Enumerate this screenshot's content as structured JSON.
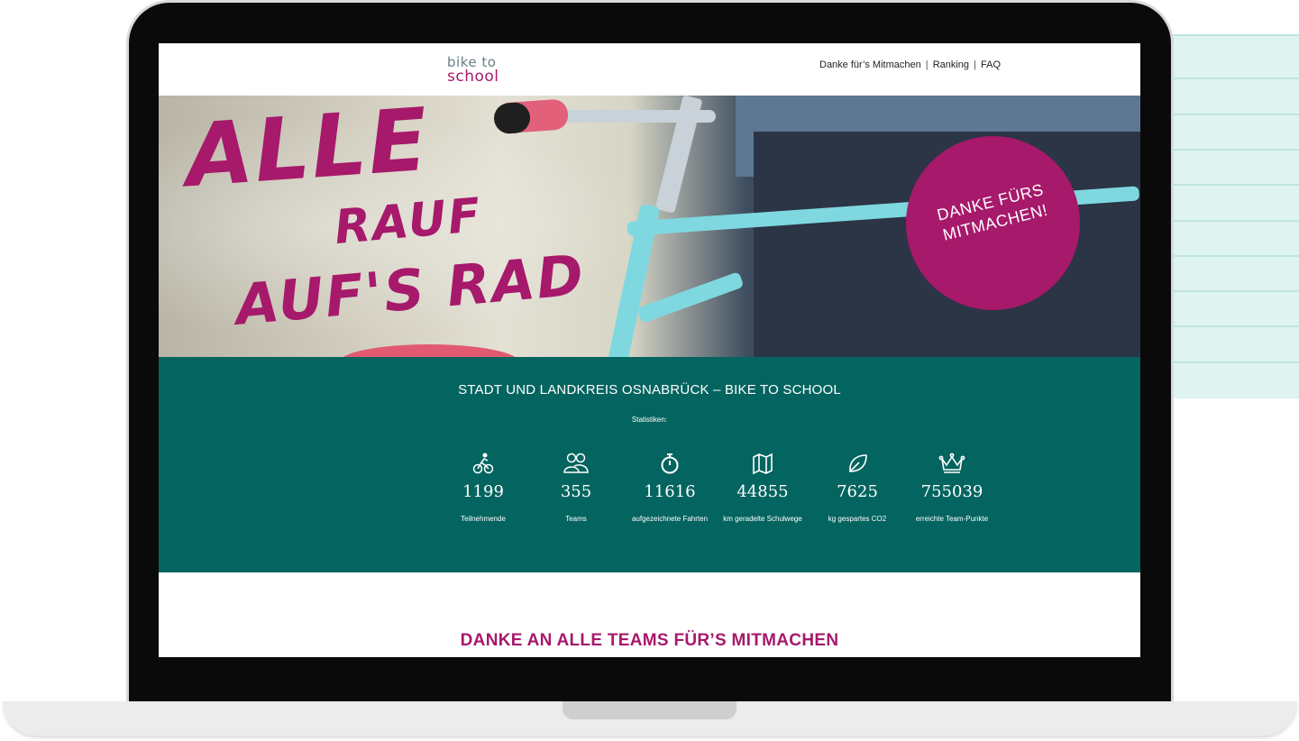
{
  "logo": {
    "line1": "bike to",
    "line2": "school"
  },
  "nav": {
    "items": [
      "Danke für’s Mitmachen",
      "Ranking",
      "FAQ"
    ],
    "separator": "|"
  },
  "hero": {
    "title_line1": "ALLE",
    "title_line2": "RAUF",
    "title_line3": "AUF'S RAD",
    "badge": "DANKE FÜRS MITMACHEN!"
  },
  "stats": {
    "title": "STADT UND LANDKREIS OSNABRÜCK – BIKE TO SCHOOL",
    "subtitle": "Statistiken:",
    "items": [
      {
        "icon": "cyclist-icon",
        "value": "1199",
        "label": "Teilnehmende"
      },
      {
        "icon": "team-icon",
        "value": "355",
        "label": "Teams"
      },
      {
        "icon": "stopwatch-icon",
        "value": "11616",
        "label": "aufgezeichnete Fahrten"
      },
      {
        "icon": "map-icon",
        "value": "44855",
        "label": "km geradelte Schulwege"
      },
      {
        "icon": "leaf-icon",
        "value": "7625",
        "label": "kg gespartes CO2"
      },
      {
        "icon": "crown-icon",
        "value": "755039",
        "label": "erreichte Team-Punkte"
      }
    ]
  },
  "section": {
    "heading": "DANKE AN ALLE TEAMS FÜR’S MITMACHEN"
  },
  "colors": {
    "accent": "#a6196b",
    "band": "#04645f",
    "frame": "#7fd8e0"
  }
}
